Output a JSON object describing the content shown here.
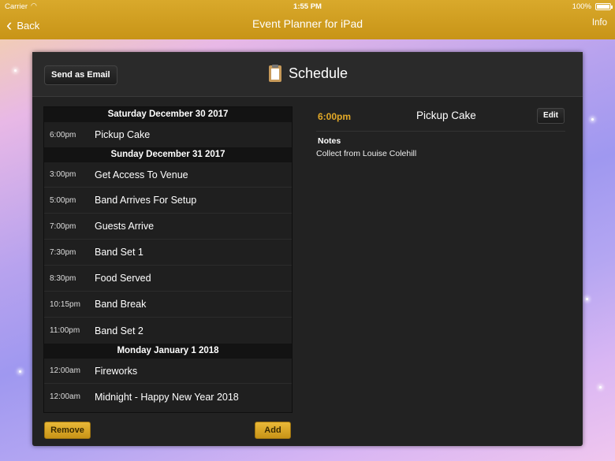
{
  "status_bar": {
    "carrier": "Carrier",
    "time": "1:55 PM",
    "battery_percent": "100%"
  },
  "nav": {
    "back_label": "Back",
    "title": "Event Planner for iPad",
    "info_label": "Info"
  },
  "header": {
    "email_button": "Send as Email",
    "title": "Schedule"
  },
  "schedule": {
    "days": [
      {
        "date": "Saturday December 30 2017",
        "items": [
          {
            "time": "6:00pm",
            "name": "Pickup Cake"
          }
        ]
      },
      {
        "date": "Sunday December 31 2017",
        "items": [
          {
            "time": "3:00pm",
            "name": "Get Access To Venue"
          },
          {
            "time": "5:00pm",
            "name": "Band Arrives For Setup"
          },
          {
            "time": "7:00pm",
            "name": "Guests Arrive"
          },
          {
            "time": "7:30pm",
            "name": "Band Set 1"
          },
          {
            "time": "8:30pm",
            "name": "Food Served"
          },
          {
            "time": "10:15pm",
            "name": "Band Break"
          },
          {
            "time": "11:00pm",
            "name": "Band Set 2"
          }
        ]
      },
      {
        "date": "Monday January 1 2018",
        "items": [
          {
            "time": "12:00am",
            "name": "Fireworks"
          },
          {
            "time": "12:00am",
            "name": "Midnight - Happy New Year 2018"
          }
        ]
      }
    ]
  },
  "buttons": {
    "remove": "Remove",
    "add": "Add",
    "edit": "Edit"
  },
  "detail": {
    "time": "6:00pm",
    "name": "Pickup Cake",
    "notes_label": "Notes",
    "notes": "Collect from Louise Colehill"
  },
  "colors": {
    "accent_gold": "#d9a92b",
    "detail_time": "#e3a927",
    "panel_bg": "#222222"
  }
}
